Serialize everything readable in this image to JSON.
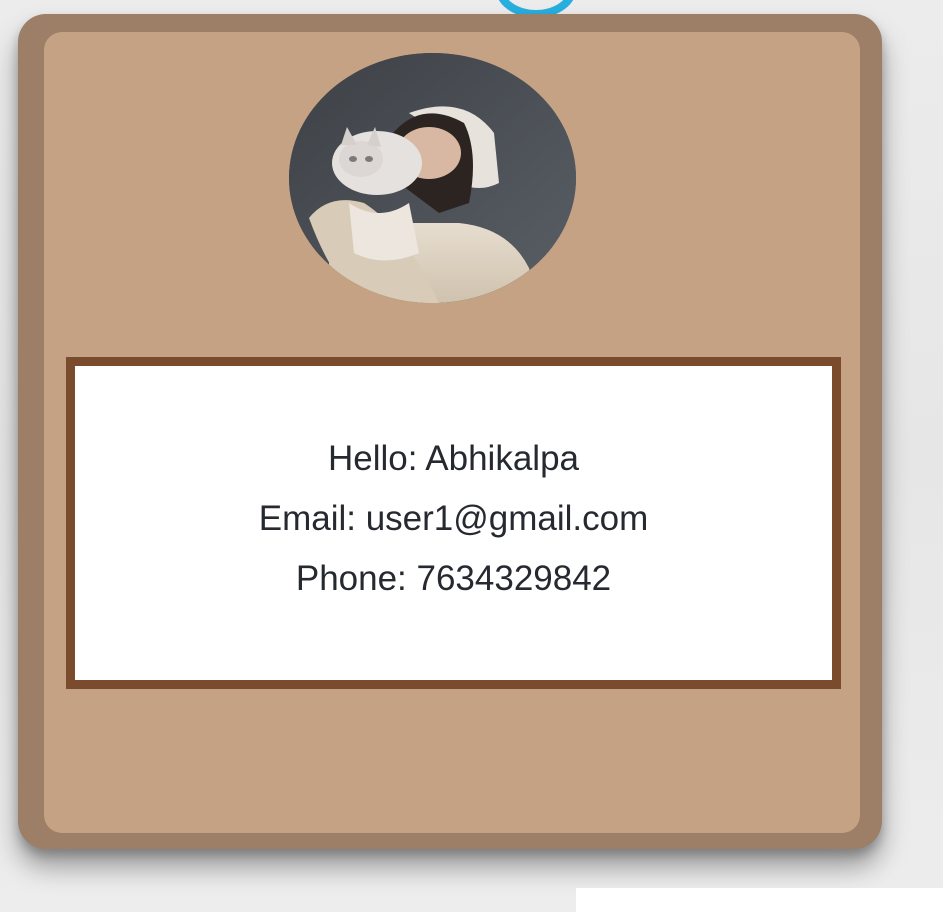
{
  "profile": {
    "avatar_icon": "profile-photo-avatar",
    "hello_text": "Hello: Abhikalpa",
    "email_text": "Email: user1@gmail.com",
    "phone_text": "Phone: 7634329842"
  },
  "colors": {
    "card_outer": "#9c7f66",
    "card_inner": "#c5a283",
    "info_border": "#7a4b2d",
    "accent_ring": "#29aee0",
    "text": "#262a30"
  }
}
